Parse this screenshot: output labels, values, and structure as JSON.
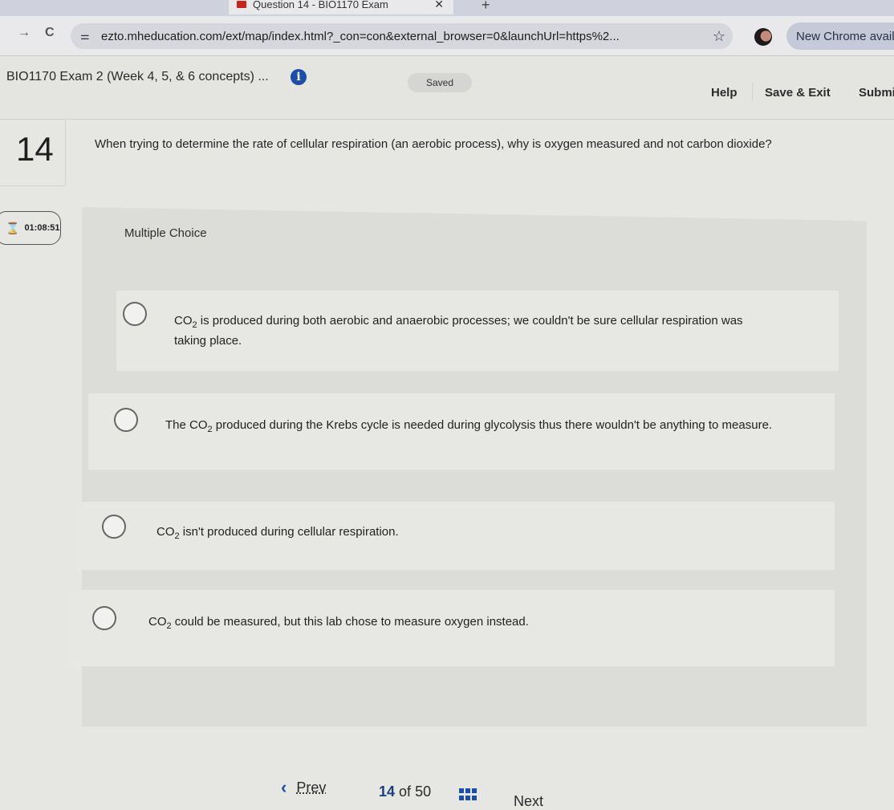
{
  "browser": {
    "tab_title": "Question 14 - BIO1170 Exam",
    "url": "ezto.mheducation.com/ext/map/index.html?_con=con&external_browser=0&launchUrl=https%2...",
    "chrome_update_label": "New Chrome available"
  },
  "header": {
    "exam_title": "BIO1170 Exam 2 (Week 4, 5, & 6 concepts) ...",
    "saved_label": "Saved",
    "help_label": "Help",
    "save_exit_label": "Save & Exit",
    "submit_label": "Submit"
  },
  "question": {
    "number": "14",
    "prompt": "When trying to determine the rate of cellular respiration (an aerobic process), why is oxygen measured and not carbon dioxide?",
    "type": "Multiple Choice",
    "timer": "01:08:51",
    "choices": [
      {
        "pre": "",
        "chem": "CO",
        "sub": "2",
        "text": " is produced during both aerobic and anaerobic processes; we couldn't be sure cellular respiration was taking place.",
        "selected": false
      },
      {
        "pre": "The ",
        "chem": "CO",
        "sub": "2",
        "text": " produced during the Krebs cycle is needed during glycolysis thus there wouldn't be anything to measure.",
        "selected": false
      },
      {
        "pre": "",
        "chem": "CO",
        "sub": "2",
        "text": " isn't produced during cellular respiration.",
        "selected": false
      },
      {
        "pre": "",
        "chem": "CO",
        "sub": "2",
        "text": " could be measured, but this lab chose to measure oxygen instead.",
        "selected": false
      }
    ]
  },
  "footer": {
    "prev_label": "Prev",
    "current_page": "14",
    "of_label": "of",
    "total_pages": "50",
    "next_label": "Next"
  },
  "colors": {
    "accent": "#1b4ea8",
    "background": "#e6e6e3"
  }
}
